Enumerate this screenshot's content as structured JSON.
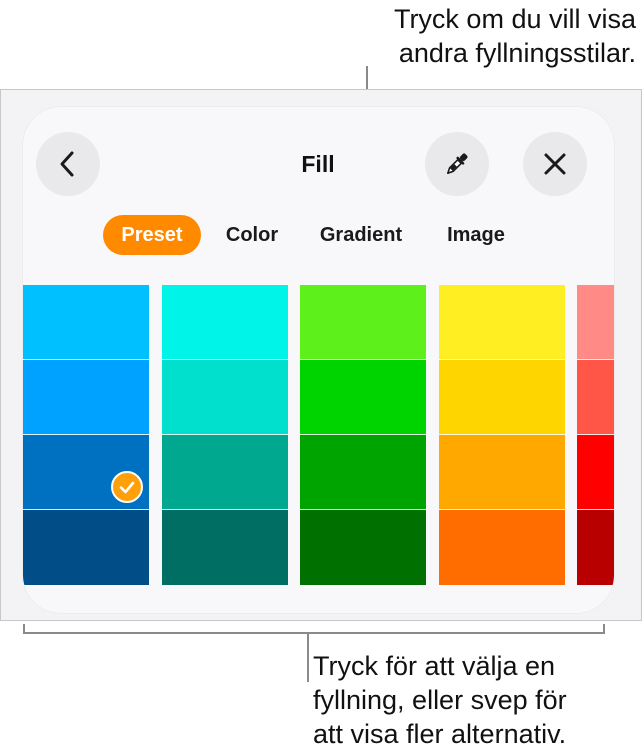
{
  "callouts": {
    "top": [
      "Tryck om du vill visa",
      "andra fyllningsstilar."
    ],
    "bottom": [
      "Tryck för att välja en",
      "fyllning, eller svep för",
      "att visa fler alternativ."
    ]
  },
  "panel": {
    "title": "Fill",
    "back_icon": "chevron-left-icon",
    "eyedropper_icon": "eyedropper-icon",
    "close_icon": "close-icon"
  },
  "tabs": [
    {
      "label": "Preset",
      "active": true
    },
    {
      "label": "Color",
      "active": false
    },
    {
      "label": "Gradient",
      "active": false
    },
    {
      "label": "Image",
      "active": false
    }
  ],
  "swatches": [
    {
      "name": "blue",
      "colors": [
        "#00c0ff",
        "#00a2ff",
        "#0070c0",
        "#004d88"
      ]
    },
    {
      "name": "teal",
      "colors": [
        "#00f4e8",
        "#00e0cc",
        "#00a890",
        "#006e62"
      ]
    },
    {
      "name": "green",
      "colors": [
        "#5ef01a",
        "#00d400",
        "#00a400",
        "#007000"
      ]
    },
    {
      "name": "yellow",
      "colors": [
        "#ffef22",
        "#ffd500",
        "#ffa800",
        "#ff6c00"
      ]
    },
    {
      "name": "red",
      "colors": [
        "#ff8a86",
        "#ff5648",
        "#ff0000",
        "#b80000"
      ]
    }
  ],
  "selected_swatch": {
    "column": 0,
    "row": 2
  },
  "accent_color": "#ff8a00"
}
